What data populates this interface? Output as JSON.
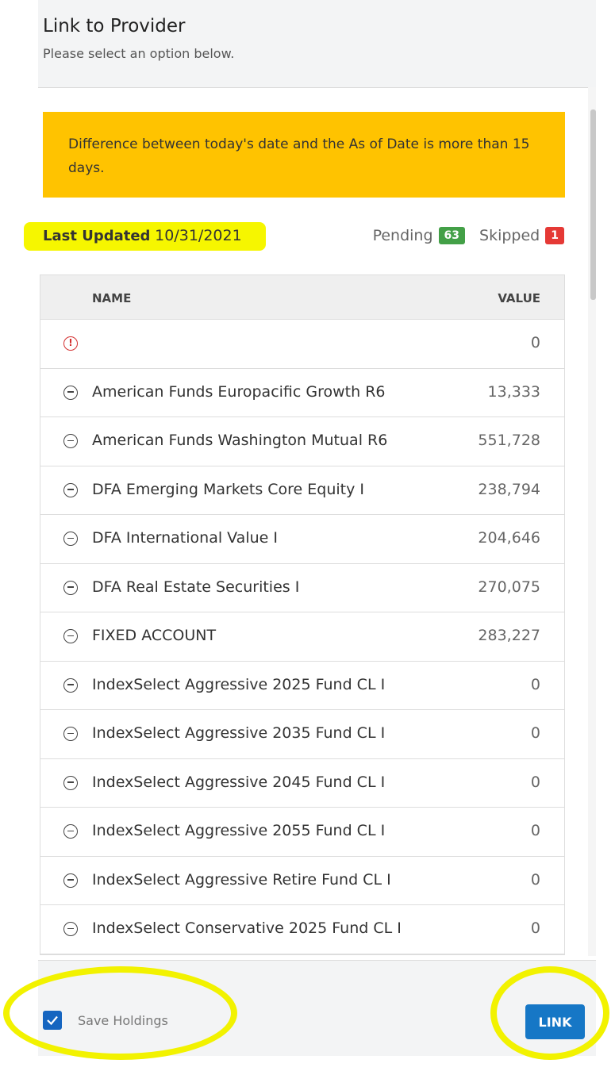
{
  "dialog": {
    "title": "Link to Provider",
    "subtitle": "Please select an option below."
  },
  "alert": {
    "message": "Difference between today's date and the As of Date is more than 15 days."
  },
  "status": {
    "last_updated_label": "Last Updated",
    "last_updated_date": "10/31/2021",
    "pending_label": "Pending",
    "pending_count": "63",
    "skipped_label": "Skipped",
    "skipped_count": "1"
  },
  "table": {
    "headers": {
      "name": "NAME",
      "value": "VALUE"
    },
    "rows": [
      {
        "icon": "warning-icon",
        "name": "",
        "value": "0"
      },
      {
        "icon": "minus-circle-icon",
        "name": "American Funds Europacific Growth R6",
        "value": "13,333"
      },
      {
        "icon": "minus-circle-icon",
        "name": "American Funds Washington Mutual R6",
        "value": "551,728"
      },
      {
        "icon": "minus-circle-icon",
        "name": "DFA Emerging Markets Core Equity I",
        "value": "238,794"
      },
      {
        "icon": "minus-circle-icon",
        "name": "DFA International Value I",
        "value": "204,646"
      },
      {
        "icon": "minus-circle-icon",
        "name": "DFA Real Estate Securities I",
        "value": "270,075"
      },
      {
        "icon": "minus-circle-icon",
        "name": "FIXED ACCOUNT",
        "value": "283,227"
      },
      {
        "icon": "minus-circle-icon",
        "name": "IndexSelect Aggressive 2025 Fund CL I",
        "value": "0"
      },
      {
        "icon": "minus-circle-icon",
        "name": "IndexSelect Aggressive 2035 Fund CL I",
        "value": "0"
      },
      {
        "icon": "minus-circle-icon",
        "name": "IndexSelect Aggressive 2045 Fund CL I",
        "value": "0"
      },
      {
        "icon": "minus-circle-icon",
        "name": "IndexSelect Aggressive 2055 Fund CL I",
        "value": "0"
      },
      {
        "icon": "minus-circle-icon",
        "name": "IndexSelect Aggressive Retire Fund CL I",
        "value": "0"
      },
      {
        "icon": "minus-circle-icon",
        "name": "IndexSelect Conservative 2025 Fund CL I",
        "value": "0"
      }
    ]
  },
  "footer": {
    "save_holdings_label": "Save Holdings",
    "save_holdings_checked": true,
    "link_label": "LINK"
  },
  "colors": {
    "alert_bg": "#ffc300",
    "pending_badge": "#43a047",
    "skipped_badge": "#e53935",
    "primary_button": "#1677c6",
    "highlight": "#f6f600"
  }
}
